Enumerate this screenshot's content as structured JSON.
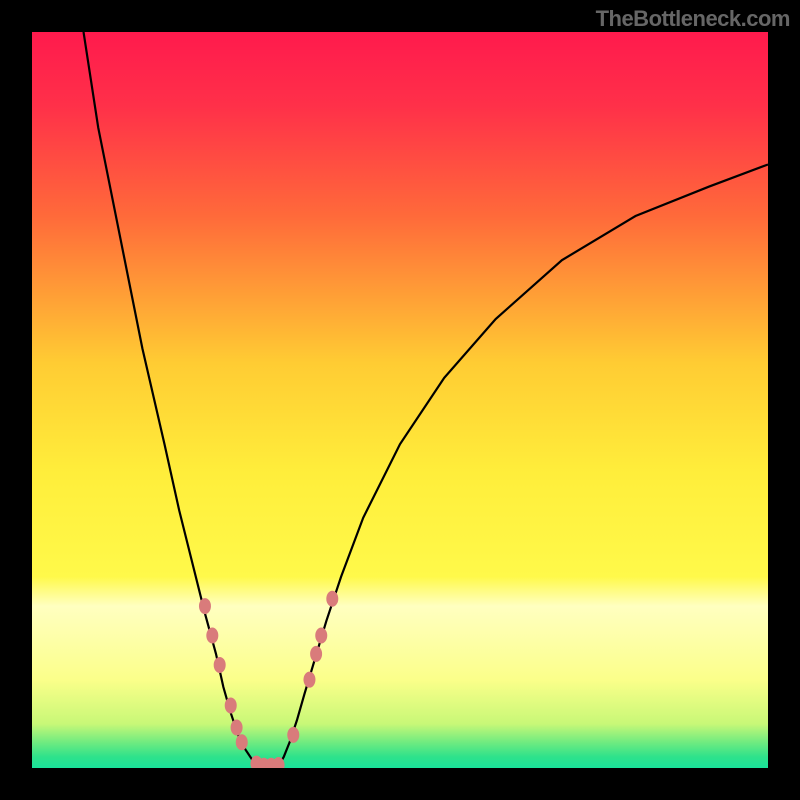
{
  "watermark": "TheBottleneck.com",
  "chart_data": {
    "type": "line",
    "title": "",
    "xlabel": "",
    "ylabel": "",
    "xlim": [
      0,
      100
    ],
    "ylim": [
      0,
      100
    ],
    "background": {
      "type": "vertical-gradient",
      "stops": [
        {
          "pos": 0.0,
          "color": "#ff1a4d"
        },
        {
          "pos": 0.1,
          "color": "#ff3049"
        },
        {
          "pos": 0.25,
          "color": "#ff6a3a"
        },
        {
          "pos": 0.45,
          "color": "#ffcc33"
        },
        {
          "pos": 0.6,
          "color": "#ffee3b"
        },
        {
          "pos": 0.74,
          "color": "#fff94a"
        },
        {
          "pos": 0.78,
          "color": "#ffffc0"
        },
        {
          "pos": 0.88,
          "color": "#fbff8a"
        },
        {
          "pos": 0.94,
          "color": "#c8f877"
        },
        {
          "pos": 0.965,
          "color": "#70eb80"
        },
        {
          "pos": 0.985,
          "color": "#2ee28b"
        },
        {
          "pos": 1.0,
          "color": "#1ae29a"
        }
      ]
    },
    "series": [
      {
        "name": "left-curve",
        "x": [
          7,
          9,
          12,
          15,
          18,
          20,
          22,
          23.5,
          25,
          26,
          27,
          28,
          29,
          30,
          30.6
        ],
        "y": [
          100,
          87,
          72,
          57,
          44,
          35,
          27,
          21,
          15.5,
          11,
          7.5,
          4.5,
          2.5,
          1,
          0.3
        ]
      },
      {
        "name": "right-curve",
        "x": [
          33.5,
          34.2,
          35,
          36,
          37,
          38.5,
          40,
          42,
          45,
          50,
          56,
          63,
          72,
          82,
          92,
          100
        ],
        "y": [
          0.3,
          1.5,
          3.5,
          6.5,
          10,
          15,
          20,
          26,
          34,
          44,
          53,
          61,
          69,
          75,
          79,
          82
        ]
      }
    ],
    "flat_bottom": {
      "x1": 30.6,
      "x2": 33.5,
      "y": 0.3
    },
    "markers": [
      {
        "x": 23.5,
        "y": 22.0
      },
      {
        "x": 24.5,
        "y": 18.0
      },
      {
        "x": 25.5,
        "y": 14.0
      },
      {
        "x": 27.0,
        "y": 8.5
      },
      {
        "x": 27.8,
        "y": 5.5
      },
      {
        "x": 28.5,
        "y": 3.5
      },
      {
        "x": 30.5,
        "y": 0.6
      },
      {
        "x": 31.5,
        "y": 0.3
      },
      {
        "x": 32.5,
        "y": 0.3
      },
      {
        "x": 33.5,
        "y": 0.4
      },
      {
        "x": 35.5,
        "y": 4.5
      },
      {
        "x": 37.7,
        "y": 12.0
      },
      {
        "x": 38.6,
        "y": 15.5
      },
      {
        "x": 39.3,
        "y": 18.0
      },
      {
        "x": 40.8,
        "y": 23.0
      }
    ],
    "marker_style": {
      "color": "#d97b7b",
      "rx": 6,
      "ry": 8
    }
  }
}
